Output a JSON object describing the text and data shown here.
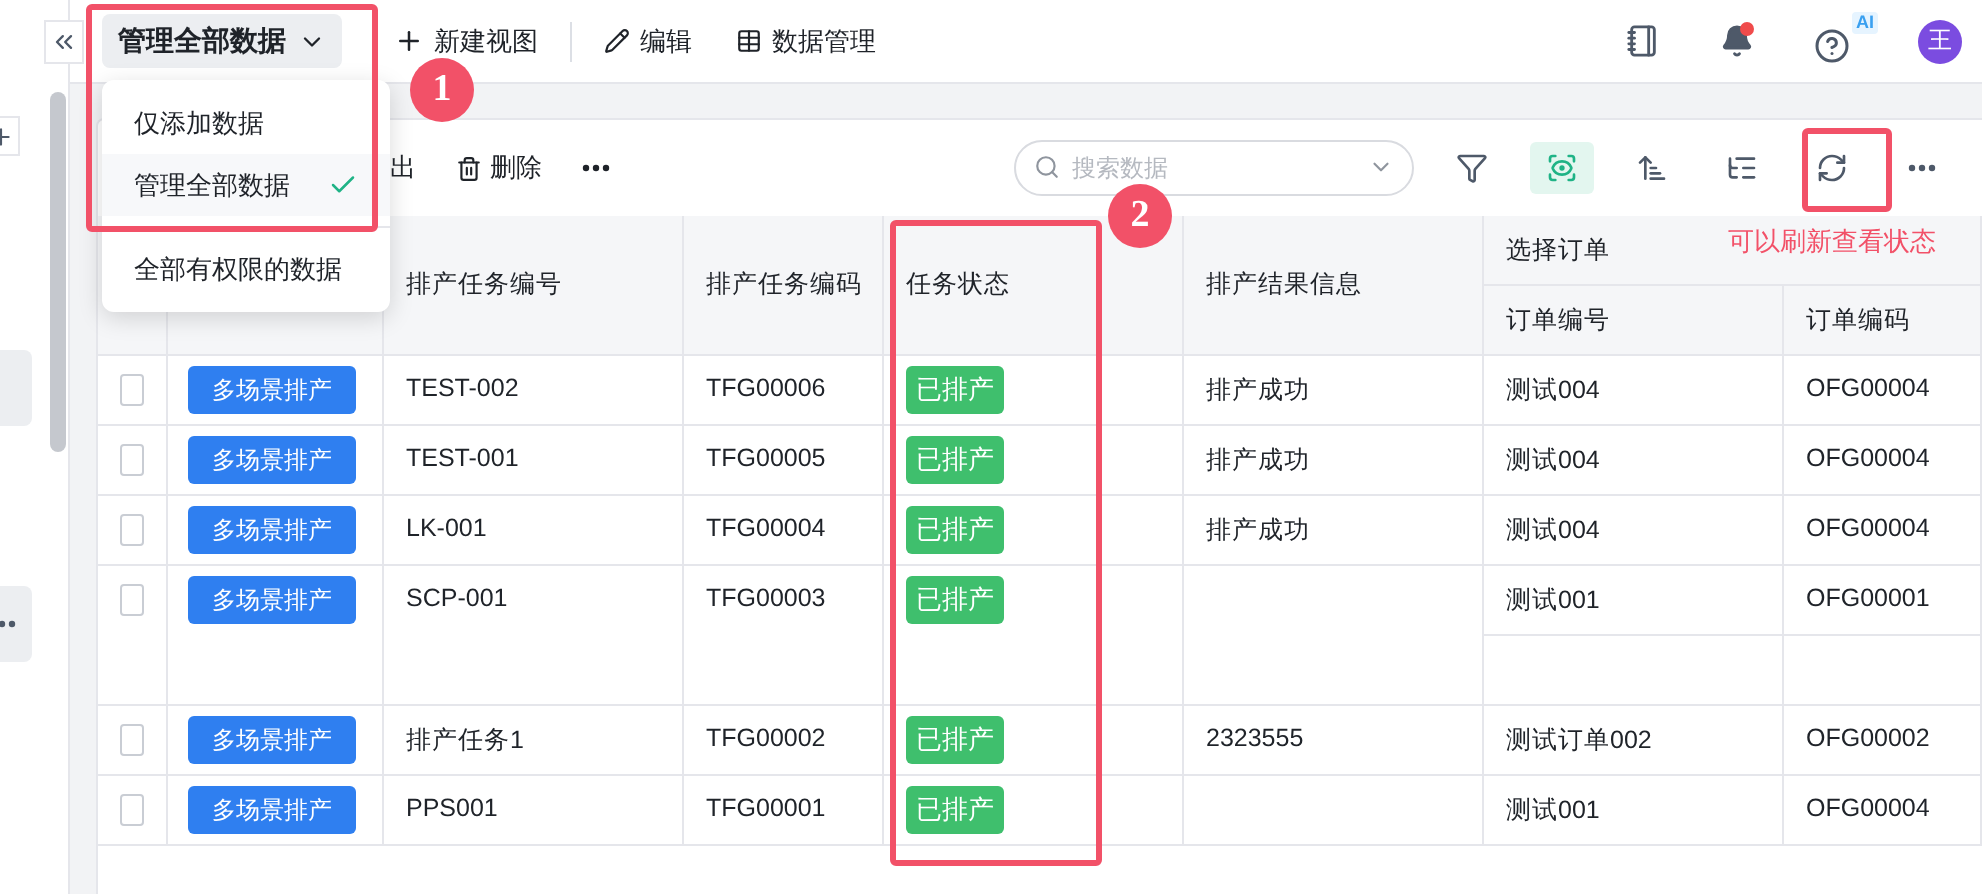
{
  "view_switcher": {
    "label": "管理全部数据",
    "expanded": true
  },
  "view_menu": {
    "options": [
      {
        "label": "仅添加数据",
        "selected": false
      },
      {
        "label": "管理全部数据",
        "selected": true
      }
    ],
    "extra": [
      {
        "label": "全部有权限的数据",
        "selected": false
      }
    ]
  },
  "top_actions": [
    {
      "kind": "plus",
      "label": "新建视图"
    },
    {
      "kind": "pencil",
      "label": "编辑"
    },
    {
      "kind": "table",
      "label": "数据管理"
    }
  ],
  "header": {
    "has_unread": true,
    "help_badge": "AI",
    "avatar": "王"
  },
  "card_toolbar": {
    "actions": [
      {
        "kind": "export",
        "label": "出"
      },
      {
        "kind": "delete",
        "label": "删除"
      }
    ],
    "search": {
      "placeholder": "搜索数据"
    },
    "tools": [
      {
        "kind": "filter",
        "selected": false
      },
      {
        "kind": "view",
        "selected": true
      },
      {
        "kind": "sort",
        "selected": false
      },
      {
        "kind": "group",
        "selected": false
      },
      {
        "kind": "refresh",
        "selected": false
      },
      {
        "kind": "more",
        "selected": false
      }
    ]
  },
  "table": {
    "columns": [
      "排产任务编号",
      "排产任务编码",
      "任务状态",
      "排产结果信息"
    ],
    "group_column": {
      "label": "选择订单",
      "columns": [
        "订单编号",
        "订单编码"
      ]
    },
    "rows": [
      {
        "action": "多场景排产",
        "number": "TEST-002",
        "code": "TFG00006",
        "status": "已排产",
        "result": "排产成功",
        "checked": false,
        "orders": [
          {
            "kind": "order",
            "number": "测试004",
            "code": "OFG00004"
          }
        ]
      },
      {
        "action": "多场景排产",
        "number": "TEST-001",
        "code": "TFG00005",
        "status": "已排产",
        "result": "排产成功",
        "checked": false,
        "orders": [
          {
            "kind": "order",
            "number": "测试004",
            "code": "OFG00004"
          }
        ]
      },
      {
        "action": "多场景排产",
        "number": "LK-001",
        "code": "TFG00004",
        "status": "已排产",
        "result": "排产成功",
        "checked": false,
        "orders": [
          {
            "kind": "order",
            "number": "测试004",
            "code": "OFG00004"
          }
        ]
      },
      {
        "action": "多场景排产",
        "number": "SCP-001",
        "code": "TFG00003",
        "status": "已排产",
        "checked": false,
        "orders": [
          {
            "kind": "order",
            "number": "测试001",
            "code": "OFG00001"
          },
          {
            "kind": "blank"
          }
        ]
      },
      {
        "action": "多场景排产",
        "number": "排产任务1",
        "code": "TFG00002",
        "status": "已排产",
        "result": "2323555",
        "checked": false,
        "orders": [
          {
            "kind": "order",
            "number": "测试订单002",
            "code": "OFG00002"
          }
        ]
      },
      {
        "action": "多场景排产",
        "number": "PPS001",
        "code": "TFG00001",
        "status": "已排产",
        "checked": false,
        "orders": [
          {
            "kind": "order",
            "number": "测试001",
            "code": "OFG00004"
          }
        ]
      }
    ]
  },
  "annotations": {
    "markers": [
      "1",
      "2"
    ],
    "note": "可以刷新查看状态"
  }
}
